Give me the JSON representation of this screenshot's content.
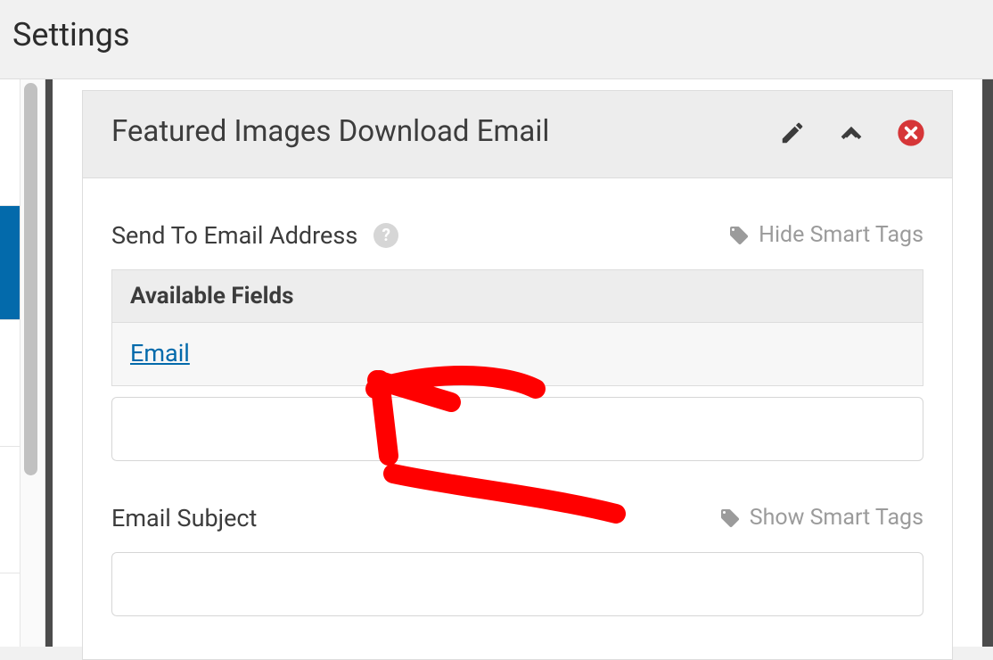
{
  "page": {
    "title": "Settings"
  },
  "panel": {
    "title": "Featured Images Download Email"
  },
  "sendTo": {
    "label": "Send To Email Address",
    "smartTagsLabel": "Hide Smart Tags",
    "availableFieldsHeader": "Available Fields",
    "emailFieldLink": "Email",
    "value": ""
  },
  "subject": {
    "label": "Email Subject",
    "smartTagsLabel": "Show Smart Tags",
    "value": ""
  }
}
